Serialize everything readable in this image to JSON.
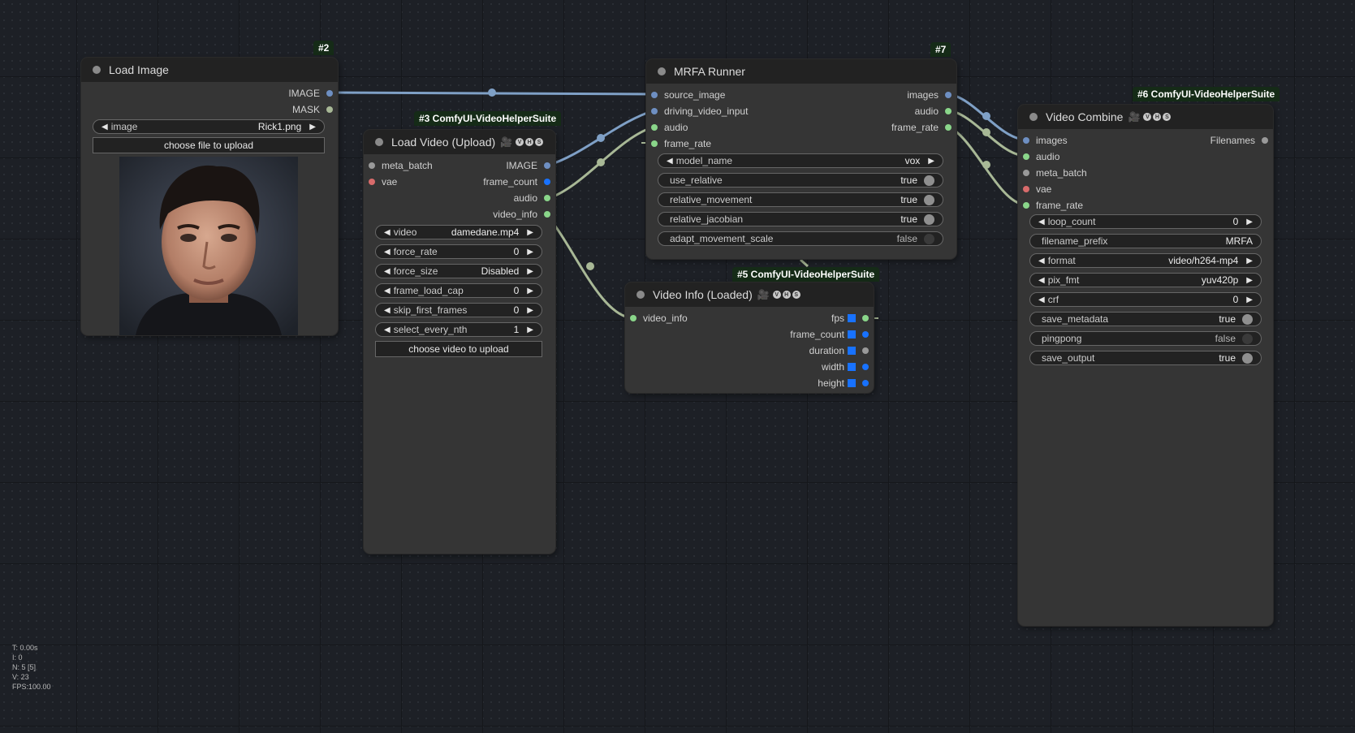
{
  "colors": {
    "image_link": "#7fa0c6",
    "audio_link": "#a8b896",
    "slot_image": "#6e8fc2",
    "slot_audio": "#8ad68a",
    "slot_red": "#d86b6b",
    "slot_grey": "#9a9a9a",
    "badge_bg": "#152b17",
    "fps_square": "#1872ff"
  },
  "nodes": {
    "load_image": {
      "badge": "#2",
      "title": "Load Image",
      "outputs": [
        "IMAGE",
        "MASK"
      ],
      "widget_image_label": "image",
      "widget_image_value": "Rick1.png",
      "upload_button": "choose file to upload",
      "preview": "portrait-image"
    },
    "load_video": {
      "badge": "#3 ComfyUI-VideoHelperSuite",
      "title": "Load Video (Upload)",
      "inputs": [
        "meta_batch",
        "vae"
      ],
      "outputs": [
        "IMAGE",
        "frame_count",
        "audio",
        "video_info"
      ],
      "widgets": [
        {
          "label": "video",
          "value": "damedane.mp4"
        },
        {
          "label": "force_rate",
          "value": "0"
        },
        {
          "label": "force_size",
          "value": "Disabled"
        },
        {
          "label": "frame_load_cap",
          "value": "0"
        },
        {
          "label": "skip_first_frames",
          "value": "0"
        },
        {
          "label": "select_every_nth",
          "value": "1"
        }
      ],
      "upload_button": "choose video to upload"
    },
    "mrfa_runner": {
      "badge": "#7",
      "title": "MRFA Runner",
      "inputs": [
        "source_image",
        "driving_video_input",
        "audio",
        "frame_rate"
      ],
      "outputs": [
        "images",
        "audio",
        "frame_rate"
      ],
      "widgets": [
        {
          "label": "model_name",
          "value": "vox",
          "kind": "combo"
        },
        {
          "label": "use_relative",
          "value": "true",
          "kind": "toggle"
        },
        {
          "label": "relative_movement",
          "value": "true",
          "kind": "toggle"
        },
        {
          "label": "relative_jacobian",
          "value": "true",
          "kind": "toggle"
        },
        {
          "label": "adapt_movement_scale",
          "value": "false",
          "kind": "toggle-off"
        }
      ]
    },
    "video_info": {
      "badge": "#5 ComfyUI-VideoHelperSuite",
      "title": "Video Info (Loaded)",
      "inputs": [
        "video_info"
      ],
      "outputs": [
        "fps",
        "frame_count",
        "duration",
        "width",
        "height"
      ]
    },
    "video_combine": {
      "badge": "#6 ComfyUI-VideoHelperSuite",
      "title": "Video Combine",
      "inputs": [
        "images",
        "audio",
        "meta_batch",
        "vae",
        "frame_rate"
      ],
      "outputs": [
        "Filenames"
      ],
      "widgets": [
        {
          "label": "loop_count",
          "value": "0",
          "kind": "number"
        },
        {
          "label": "filename_prefix",
          "value": "MRFA",
          "kind": "text"
        },
        {
          "label": "format",
          "value": "video/h264-mp4",
          "kind": "combo"
        },
        {
          "label": "pix_fmt",
          "value": "yuv420p",
          "kind": "combo"
        },
        {
          "label": "crf",
          "value": "0",
          "kind": "number"
        },
        {
          "label": "save_metadata",
          "value": "true",
          "kind": "toggle"
        },
        {
          "label": "pingpong",
          "value": "false",
          "kind": "toggle-off"
        },
        {
          "label": "save_output",
          "value": "true",
          "kind": "toggle"
        }
      ]
    }
  },
  "stats": [
    "T: 0.00s",
    "I: 0",
    "N: 5 [5]",
    "V: 23",
    "FPS:100.00"
  ]
}
